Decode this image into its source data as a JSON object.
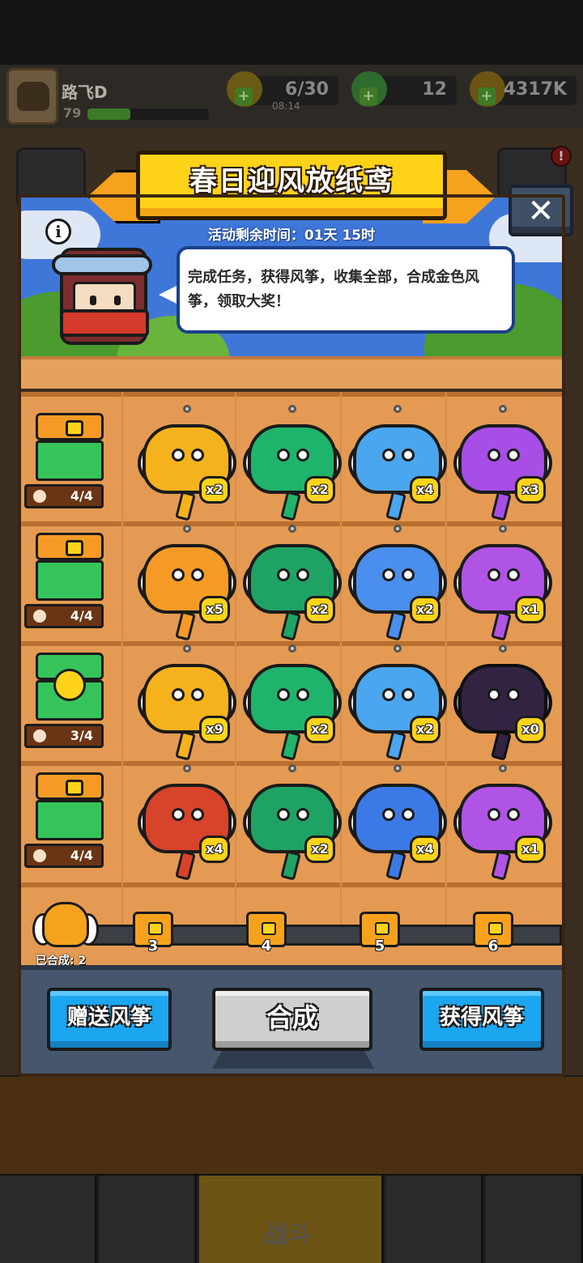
{
  "hud": {
    "player_name": "路飞D",
    "player_level": "79",
    "xp_fraction": 0.35,
    "energy": "6/30",
    "energy_timer": "08:14",
    "gems": "12",
    "coins": "4317K"
  },
  "bottom_nav": {
    "battle_label": "战斗"
  },
  "modal": {
    "title": "春日迎风放纸鸢",
    "timer": "活动剩余时间：01天 15时",
    "description": "完成任务，获得风筝，收集全部，合成金色风筝，领取大奖！",
    "info_icon": "i",
    "close_icon": "✕"
  },
  "rows": [
    {
      "reward_progress": "4/4",
      "kites": [
        {
          "color": "#f6b21c",
          "count": "x2"
        },
        {
          "color": "#1fb46b",
          "count": "x2"
        },
        {
          "color": "#4aa6ee",
          "count": "x4"
        },
        {
          "color": "#a74ee6",
          "count": "x3"
        }
      ]
    },
    {
      "reward_progress": "4/4",
      "kites": [
        {
          "color": "#f59b25",
          "count": "x5"
        },
        {
          "color": "#1fa364",
          "count": "x2"
        },
        {
          "color": "#4a8fee",
          "count": "x2"
        },
        {
          "color": "#b054e6",
          "count": "x1"
        }
      ]
    },
    {
      "reward_progress": "3/4",
      "kites": [
        {
          "color": "#f6b21c",
          "count": "x9"
        },
        {
          "color": "#1fb46b",
          "count": "x2"
        },
        {
          "color": "#4aa6ee",
          "count": "x2"
        },
        {
          "color": "#5c3f7a",
          "count": "x0"
        }
      ]
    },
    {
      "reward_progress": "4/4",
      "kites": [
        {
          "color": "#d8432b",
          "count": "x4"
        },
        {
          "color": "#1fa364",
          "count": "x2"
        },
        {
          "color": "#3b7ae6",
          "count": "x4"
        },
        {
          "color": "#b054e6",
          "count": "x1"
        }
      ]
    }
  ],
  "merge": {
    "merged_label": "已合成: 2",
    "milestones": [
      "3",
      "4",
      "5",
      "6"
    ]
  },
  "actions": {
    "gift": "赠送风筝",
    "merge": "合成",
    "obtain": "获得风筝"
  }
}
